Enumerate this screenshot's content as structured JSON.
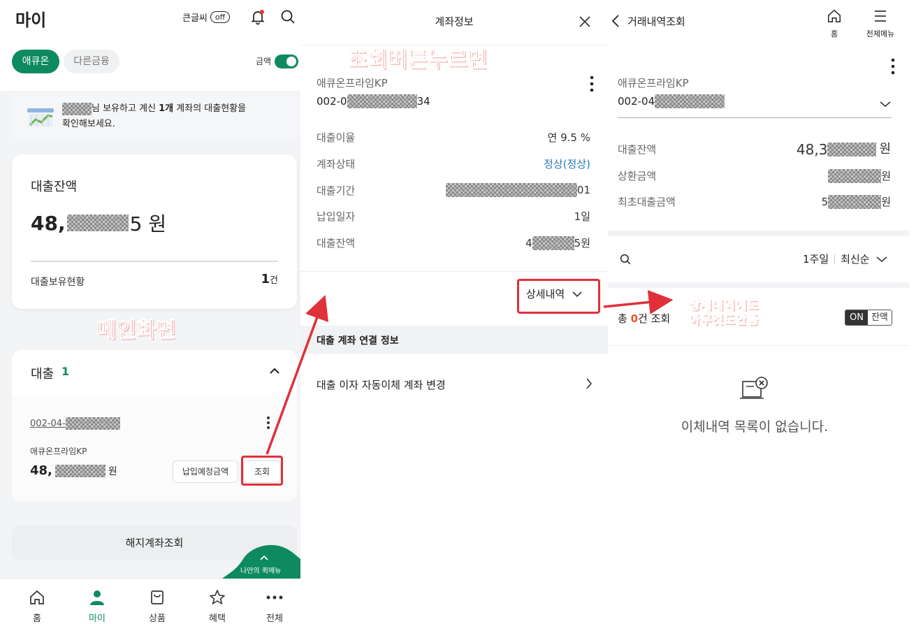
{
  "annotations": {
    "main_screen": "메인화면",
    "press_inquiry": "조회버튼누르면",
    "detail_empty_line1": "상세내역에도",
    "detail_empty_line2": "아무것도안뜸"
  },
  "main": {
    "title": "마이",
    "large_font_label": "큰글씨",
    "large_font_toggle": "off",
    "tabs": [
      "애큐온",
      "다른금융"
    ],
    "amount_toggle_label": "금액",
    "banner_text_a": "님 보유하고 계신 ",
    "banner_text_bold": "1개",
    "banner_text_b": " 계좌의 대출현황을",
    "banner_text_line2": "확인해보세요.",
    "balance_card": {
      "title": "대출잔액",
      "amount_prefix": "48,",
      "amount_suffix": "5 원",
      "holding_label": "대출보유현황",
      "holding_count": "1",
      "holding_unit": "건"
    },
    "loan_section": {
      "title": "대출",
      "count": "1",
      "account_prefix": "002-04-",
      "product_name": "애큐온프라임KP",
      "amount_prefix": "48,",
      "amount_suffix": "원",
      "scheduled_payment_button": "납입예정금액",
      "inquiry_button": "조회"
    },
    "closed_accounts_button": "해지계좌조회",
    "quick_menu_label": "나만의 퀵메뉴",
    "bottom_nav": [
      "홈",
      "마이",
      "상품",
      "혜택",
      "전체"
    ]
  },
  "account_info": {
    "title": "계좌정보",
    "product_name": "애큐온프라임KP",
    "account_prefix": "002-0",
    "account_suffix": "34",
    "rows": [
      {
        "label": "대출이율",
        "value": "연 9.5 %"
      },
      {
        "label": "계좌상태",
        "value": "정상(정상)"
      },
      {
        "label": "대출기간",
        "value": "01"
      },
      {
        "label": "납입일자",
        "value": "1일"
      },
      {
        "label": "대출잔액",
        "value_prefix": "4",
        "value_suffix": "5원"
      }
    ],
    "detail_button": "상세내역",
    "linked_section_title": "대출 계좌 연결 정보",
    "auto_transfer_item": "대출 이자 자동이체 계좌 변경",
    "status_color": "#2a7ab8"
  },
  "history": {
    "title": "거래내역조회",
    "home_label": "홈",
    "menu_label": "전체메뉴",
    "product_name": "애큐온프라임KP",
    "account_prefix": "002-04",
    "rows": [
      {
        "label": "대출잔액",
        "value_prefix": "48,3",
        "value_suffix": "원"
      },
      {
        "label": "상환금액",
        "value_suffix": "원"
      },
      {
        "label": "최초대출금액",
        "value_prefix": "5",
        "value_suffix": "원"
      }
    ],
    "period": "1주일",
    "sort": "최신순",
    "total_prefix": "총 ",
    "total_count": "0",
    "total_suffix": "건 조회",
    "toggle_on": "ON",
    "toggle_balance": "잔액",
    "empty_message": "이체내역 목록이 없습니다."
  },
  "colors": {
    "brand_green": "#0d8a5f",
    "annotation_red": "#e0303a",
    "count_orange": "#e8542a"
  }
}
